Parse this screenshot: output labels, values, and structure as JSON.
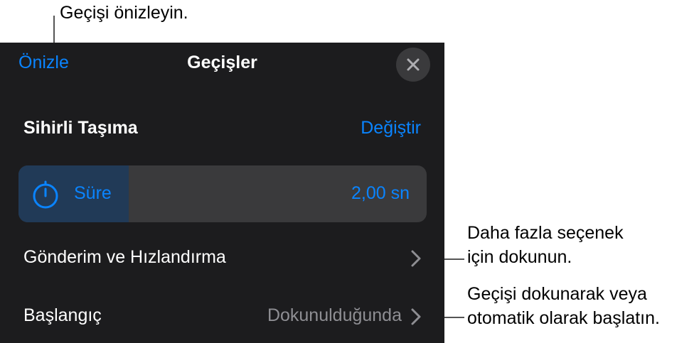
{
  "callouts": {
    "preview": "Geçişi önizleyin.",
    "more_options": [
      "Daha fazla seçenek",
      "için dokunun."
    ],
    "start": [
      "Geçişi dokunarak veya",
      "otomatik olarak başlatın."
    ]
  },
  "header": {
    "preview_label": "Önizle",
    "title": "Geçişler",
    "close_icon": "close-icon"
  },
  "effect": {
    "name": "Sihirli Taşıma",
    "change_label": "Değiştir"
  },
  "duration": {
    "label": "Süre",
    "value": "2,00 sn",
    "icon": "stopwatch-icon",
    "fill_fraction": 0.27
  },
  "rows": [
    {
      "label": "Gönderim ve Hızlandırma",
      "value": ""
    },
    {
      "label": "Başlangıç",
      "value": "Dokunulduğunda"
    }
  ],
  "colors": {
    "accent": "#0a84ff",
    "panel_bg": "#1c1c1e",
    "control_bg": "#3a3a3c",
    "secondary_text": "#8e8e93"
  }
}
